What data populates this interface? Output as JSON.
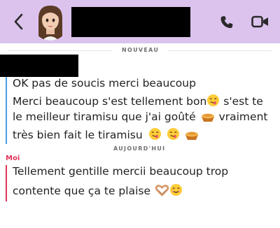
{
  "header": {
    "contact_name": "",
    "icons": {
      "back": "chevron-left-icon",
      "call": "phone-icon",
      "video": "video-camera-icon"
    },
    "background_color": "#dcc3ee"
  },
  "separators": {
    "new": "NOUVEAU",
    "today": "AUJOURD'HUI"
  },
  "conversation": {
    "other": {
      "sender_name": "",
      "bar_color": "#4b9fe8",
      "lines": [
        "OK pas de soucis merci beaucoup",
        "Merci beaucoup s'est tellement bon",
        " s'est te",
        "le meilleur tiramisu que j'ai goûté",
        " vraiment",
        "très bien fait le tiramisu"
      ]
    },
    "me": {
      "sender_name": "Moi",
      "bar_color": "#e0345a",
      "lines": [
        "Tellement gentille mercii beaucoup trop",
        "contente que ça te plaise"
      ]
    }
  },
  "emojis": {
    "yum": "face-savoring-food-emoji",
    "pie": "pie-emoji",
    "heart_hands": "heart-hands-emoji",
    "smile": "smiling-face-emoji"
  }
}
